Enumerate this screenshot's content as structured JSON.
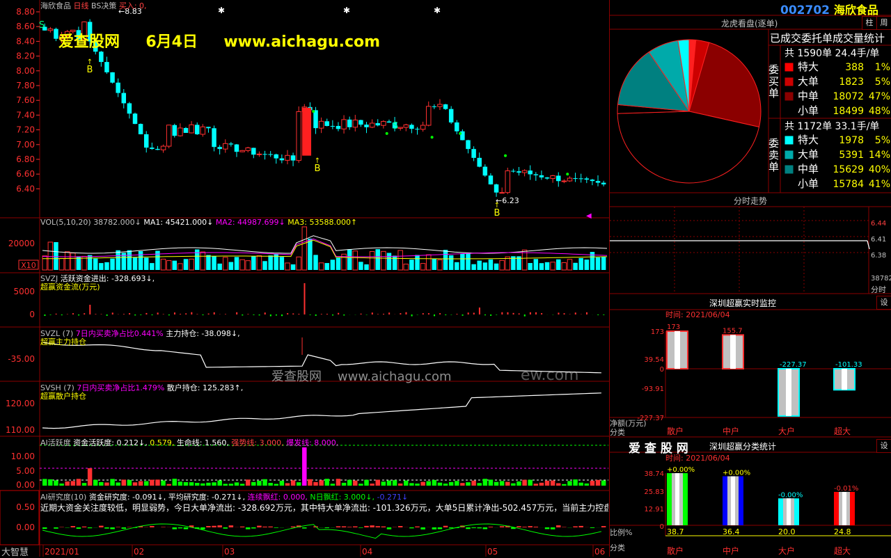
{
  "colors": {
    "up": "#ff3030",
    "down": "#00ffff",
    "ma1": "#ffffff",
    "ma2": "#ff00ff",
    "ma3": "#ffff00",
    "green": "#00ff00",
    "grid": "#8b0000",
    "yellow": "#ffff00"
  },
  "main": {
    "title": "海欣食品",
    "period": "日线",
    "indicator": "BS决策",
    "buy_text": "买入: 0,",
    "high_marker": "8.83",
    "low_marker": "6.23",
    "watermark_site": "爱查股网",
    "watermark_date": "6月4日",
    "watermark_url": "www.aichagu.com",
    "price_ticks": [
      "8.80",
      "8.60",
      "8.40",
      "8.20",
      "8.00",
      "7.80",
      "7.60",
      "7.40",
      "7.20",
      "7.00",
      "6.80",
      "6.60",
      "6.40"
    ],
    "signals": {
      "s": "S",
      "b": "B"
    }
  },
  "vol": {
    "label": "VOL(5,10,20)",
    "v": "38782.000↓",
    "ma1": "MA1: 45421.000↓",
    "ma2": "MA2: 44987.699↓",
    "ma3": "MA3: 53588.000↑",
    "tick": "20000",
    "unit": "X10"
  },
  "svzj": {
    "name": "SVZJ",
    "text1": "活跃资金进出: -328.693↓,",
    "text2": "超赢资金流(万元)",
    "ticks": [
      "5000",
      "0"
    ]
  },
  "svzl": {
    "name": "SVZL (7)",
    "text1": "7日内买卖净占比0.441%",
    "text2": "主力持仓: -38.098↓,",
    "text3": "超赢主力持仓",
    "tick": "-35.00"
  },
  "svsh": {
    "name": "SVSH (7)",
    "text1": "7日内买卖净占比1.479%",
    "text2": "散户持仓: 125.283↑,",
    "text3": "超赢散户持仓",
    "ticks": [
      "120.00",
      "110.00"
    ]
  },
  "ai_active": {
    "name": "AI活跃度",
    "t1": "资金活跃度: 0.212↓,",
    "t2": "0.579,",
    "t3": "生命线: 1.560,",
    "t4": "强势线: 3.000,",
    "t5": "爆发线: 8.000,",
    "ticks": [
      "10.00",
      "5.00",
      "0.00"
    ]
  },
  "ai_research": {
    "name": "AI研究度(10)",
    "t1": "资金研究度: -0.091↓,",
    "t2": "平均研究度: -0.271↓,",
    "t3": "连续飘红: 0.000,",
    "t4": "N日飘红: 3.000↓,",
    "t5": "-0.271↓",
    "comment": "近期大资金关注度较低，明显弱势，今日大单净流出: -328.692万元，其中特大单净流出: -101.326万元，大单5日累计净出-502.457万元，当前主力控盘弱",
    "ticks": [
      "0.50",
      "0.00"
    ]
  },
  "center_watermark": "爱查股网    www.aichagu.com",
  "center_watermark2": "ew.com",
  "bottom": {
    "brand": "大智慧",
    "dates": [
      "2021/01",
      "02",
      "03",
      "04",
      "05",
      "06"
    ]
  },
  "right": {
    "code": "002702",
    "name": "海欣食品",
    "btn_zhu": "柱",
    "btn_zhou": "周",
    "panel1_title": "龙虎看盘(逐单)",
    "stats_title": "已成交委托单成交量统计",
    "buy_label": "委买单",
    "sell_label": "委卖单",
    "buy_total": "共 1590单 24.4手/单",
    "sell_total": "共 1172单 33.1手/单",
    "buy_rows": [
      {
        "label": "特大",
        "value": "388",
        "pct": "1%",
        "color": "#ff0000"
      },
      {
        "label": "大单",
        "value": "1823",
        "pct": "5%",
        "color": "#cc0000"
      },
      {
        "label": "中单",
        "value": "18072",
        "pct": "47%",
        "color": "#8b0000"
      },
      {
        "label": "小单",
        "value": "18499",
        "pct": "48%",
        "color": "#000000"
      }
    ],
    "sell_rows": [
      {
        "label": "特大",
        "value": "1978",
        "pct": "5%",
        "color": "#00ffff"
      },
      {
        "label": "大单",
        "value": "5391",
        "pct": "14%",
        "color": "#00aaaa"
      },
      {
        "label": "中单",
        "value": "15629",
        "pct": "40%",
        "color": "#008080"
      },
      {
        "label": "小单",
        "value": "15784",
        "pct": "41%",
        "color": "#000000"
      }
    ],
    "panel2_title": "分时走势",
    "intraday_ticks": [
      "6.44",
      "6.41",
      "6.38"
    ],
    "intraday_vol": "38782",
    "intraday_label": "分时",
    "panel3_title": "深圳超赢实时监控",
    "panel3_btn": "设",
    "panel3_time": "时间: 2021/06/04",
    "panel3_yticks": [
      "173",
      "39.54",
      "0",
      "-93.91",
      "-227.37"
    ],
    "panel3_ylabel": "净额(万元)",
    "panel3_xlabel": "分类",
    "panel3_categories": [
      "散户",
      "中户",
      "大户",
      "超大"
    ],
    "panel3_values": [
      173,
      155.7,
      -227.37,
      -101.33
    ],
    "panel3_value_labels": [
      "173",
      "155.7",
      "-227.37",
      "-101.33"
    ],
    "panel4_watermark": "爱 查 股 网",
    "panel4_title": "深圳超赢分类统计",
    "panel4_btn": "设",
    "panel4_time": "时间: 2021/06/04",
    "panel4_yticks": [
      "38.74",
      "25.83",
      "12.91",
      "0"
    ],
    "panel4_ylabel": "比例%",
    "panel4_xlabel": "分类",
    "panel4_categories": [
      "散户",
      "中户",
      "大户",
      "超大"
    ],
    "panel4_values": [
      38.7,
      36.4,
      20.0,
      24.8
    ],
    "panel4_value_labels": [
      "38.7",
      "36.4",
      "20.0",
      "24.8"
    ],
    "panel4_changes": [
      "+0.00%",
      "+0.00%",
      "-0.00%",
      "-0.01%"
    ]
  }
}
